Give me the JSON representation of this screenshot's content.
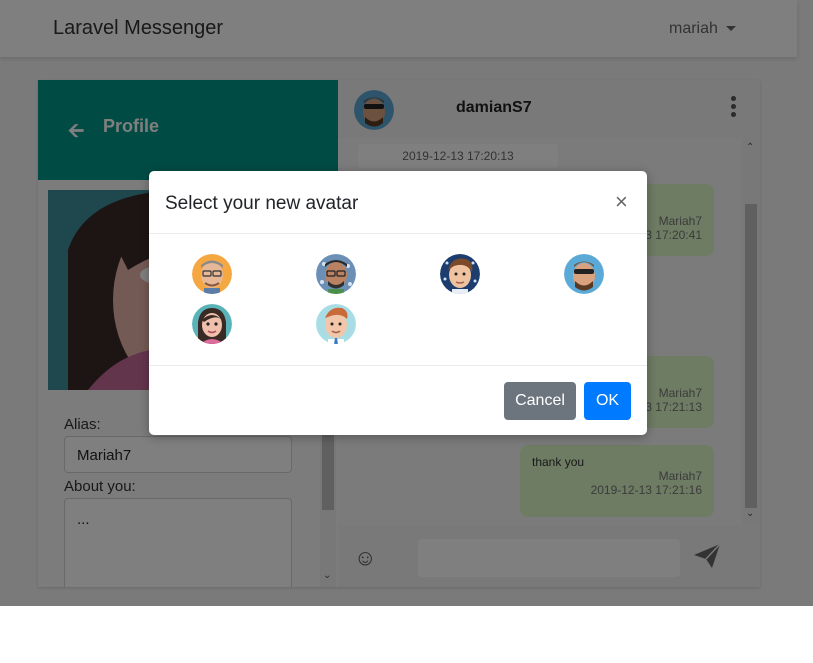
{
  "navbar": {
    "brand": "Laravel Messenger",
    "user": "mariah"
  },
  "profile": {
    "back_icon": "arrow-left-icon",
    "title": "Profile",
    "alias_label": "Alias:",
    "alias_value": "Mariah7",
    "about_label": "About you:",
    "about_value": "..."
  },
  "chat": {
    "contact_name": "damianS7",
    "menu_icon": "kebab-menu-icon",
    "date_chip": "2019-12-13 17:20:13",
    "messages": [
      {
        "text": "",
        "author": "Mariah7",
        "time": "2019-12-13 17:20:41"
      },
      {
        "text": "",
        "author": "Mariah7",
        "time": "2019-12-13 17:21:13"
      },
      {
        "text": "thank you",
        "author": "Mariah7",
        "time": "2019-12-13 17:21:16"
      }
    ],
    "emoji_icon": "smile-icon",
    "send_icon": "send-icon"
  },
  "modal": {
    "title": "Select your new avatar",
    "close_label": "×",
    "avatars": [
      {
        "name": "avatar-man-glasses-orange"
      },
      {
        "name": "avatar-man-glasses-pattern"
      },
      {
        "name": "avatar-young-man-blue"
      },
      {
        "name": "avatar-man-sunglasses-blue"
      },
      {
        "name": "avatar-woman-pink"
      },
      {
        "name": "avatar-man-light-blue"
      }
    ],
    "cancel_label": "Cancel",
    "ok_label": "OK"
  },
  "colors": {
    "header_teal": "#009688",
    "bubble_green": "#dcf8c6",
    "ok_blue": "#007bff",
    "cancel_gray": "#6c757d"
  }
}
